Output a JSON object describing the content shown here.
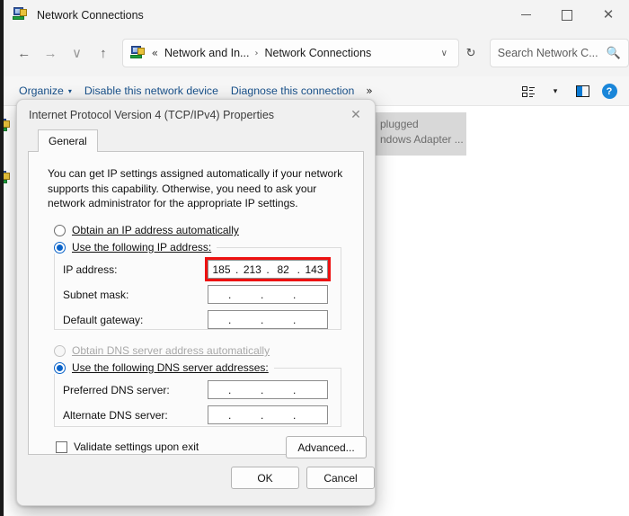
{
  "window": {
    "title": "Network Connections",
    "title_icon": "network-adapter-icon",
    "caption": {
      "minimize": "—",
      "maximize": "□",
      "close": "✕"
    }
  },
  "nav": {
    "back": "←",
    "forward": "→",
    "recent": "∨",
    "up": "↑",
    "address": {
      "icon": "network-adapter-icon",
      "chevrons": "«",
      "crumb1": "Network and In...",
      "separator": "›",
      "crumb2": "Network Connections",
      "dropdown_caret": "∨",
      "refresh": "↻"
    },
    "search": {
      "placeholder": "Search Network C...",
      "icon": "search-icon"
    }
  },
  "commandbar": {
    "organize": "Organize",
    "organize_caret": "▾",
    "disable_device": "Disable this network device",
    "diagnose": "Diagnose this connection",
    "overflow": "»",
    "view_icon": "view-layout-icon",
    "view_caret": "▾",
    "preview_pane_icon": "preview-pane-icon",
    "help_icon": "help-icon",
    "help_glyph": "?"
  },
  "background_list": {
    "tiles": [
      {
        "line1": "plugged",
        "line2": "ndows Adapter ..."
      }
    ]
  },
  "dialog": {
    "title": "Internet Protocol Version 4 (TCP/IPv4) Properties",
    "close": "✕",
    "tab": "General",
    "intro": "You can get IP settings assigned automatically if your network supports this capability. Otherwise, you need to ask your network administrator for the appropriate IP settings.",
    "ip_mode": {
      "auto_label": "Obtain an IP address automatically",
      "manual_label": "Use the following IP address:",
      "selected": "manual"
    },
    "ip_fields": [
      {
        "label": "IP address:",
        "value": [
          "185",
          "213",
          "82",
          "143"
        ],
        "highlighted": true
      },
      {
        "label": "Subnet mask:",
        "value": [
          "",
          "",
          "",
          ""
        ],
        "highlighted": false
      },
      {
        "label": "Default gateway:",
        "value": [
          "",
          "",
          "",
          ""
        ],
        "highlighted": false
      }
    ],
    "dns_mode": {
      "auto_label": "Obtain DNS server address automatically",
      "auto_disabled": true,
      "manual_label": "Use the following DNS server addresses:",
      "selected": "manual"
    },
    "dns_fields": [
      {
        "label": "Preferred DNS server:",
        "value": [
          "",
          "",
          "",
          ""
        ]
      },
      {
        "label": "Alternate DNS server:",
        "value": [
          "",
          "",
          "",
          ""
        ]
      }
    ],
    "validate": {
      "label": "Validate settings upon exit",
      "checked": false
    },
    "advanced_button": "Advanced...",
    "ok_button": "OK",
    "cancel_button": "Cancel"
  },
  "colors": {
    "accent": "#0a63c9",
    "highlight_red": "#ee1111",
    "link_blue": "#17508a",
    "help_blue": "#1a86d9"
  }
}
